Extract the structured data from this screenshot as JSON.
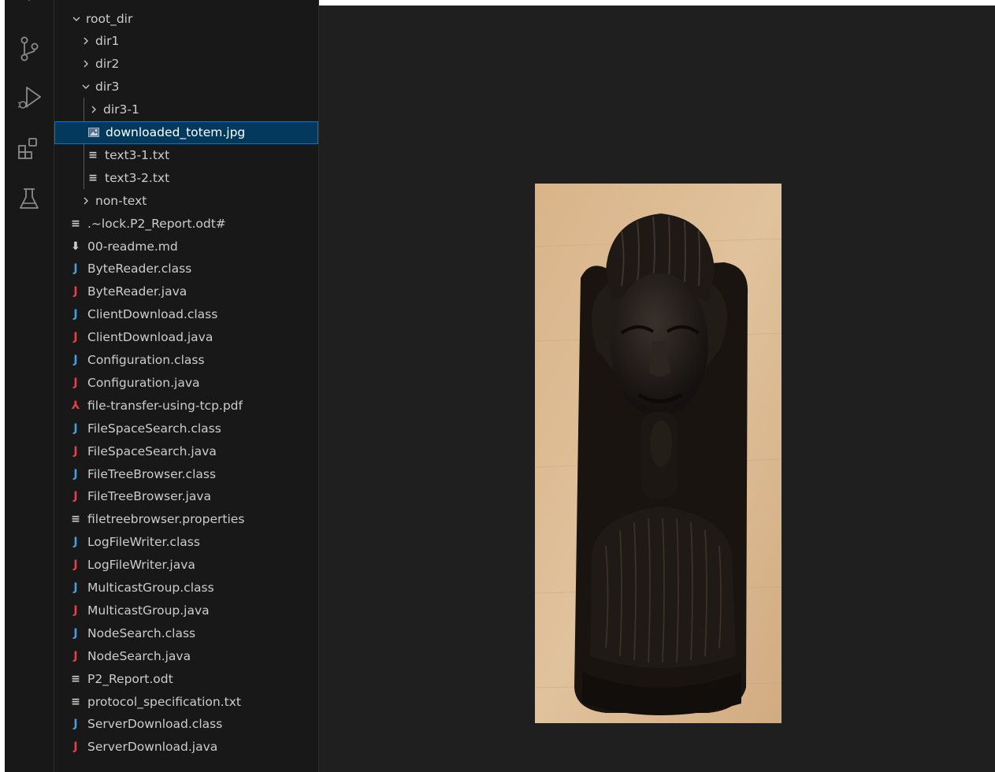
{
  "activity_bar": {
    "icons": [
      "source-control-icon",
      "run-debug-icon",
      "extensions-icon",
      "testing-icon"
    ]
  },
  "explorer": {
    "items": [
      {
        "label": "root_dir",
        "type": "folder",
        "expanded": true
      },
      {
        "label": "dir1",
        "type": "folder",
        "expanded": false
      },
      {
        "label": "dir2",
        "type": "folder",
        "expanded": false
      },
      {
        "label": "dir3",
        "type": "folder",
        "expanded": true
      },
      {
        "label": "dir3-1",
        "type": "folder",
        "expanded": false
      },
      {
        "label": "downloaded_totem.jpg",
        "type": "image",
        "selected": true
      },
      {
        "label": "text3-1.txt",
        "type": "text"
      },
      {
        "label": "text3-2.txt",
        "type": "text"
      },
      {
        "label": "non-text",
        "type": "folder",
        "expanded": false
      },
      {
        "label": ".~lock.P2_Report.odt#",
        "type": "text"
      },
      {
        "label": "00-readme.md",
        "type": "markdown"
      },
      {
        "label": "ByteReader.class",
        "type": "class"
      },
      {
        "label": "ByteReader.java",
        "type": "java"
      },
      {
        "label": "ClientDownload.class",
        "type": "class"
      },
      {
        "label": "ClientDownload.java",
        "type": "java"
      },
      {
        "label": "Configuration.class",
        "type": "class"
      },
      {
        "label": "Configuration.java",
        "type": "java"
      },
      {
        "label": "file-transfer-using-tcp.pdf",
        "type": "pdf"
      },
      {
        "label": "FileSpaceSearch.class",
        "type": "class"
      },
      {
        "label": "FileSpaceSearch.java",
        "type": "java"
      },
      {
        "label": "FileTreeBrowser.class",
        "type": "class"
      },
      {
        "label": "FileTreeBrowser.java",
        "type": "java"
      },
      {
        "label": "filetreebrowser.properties",
        "type": "text"
      },
      {
        "label": "LogFileWriter.class",
        "type": "class"
      },
      {
        "label": "LogFileWriter.java",
        "type": "java"
      },
      {
        "label": "MulticastGroup.class",
        "type": "class"
      },
      {
        "label": "MulticastGroup.java",
        "type": "java"
      },
      {
        "label": "NodeSearch.class",
        "type": "class"
      },
      {
        "label": "NodeSearch.java",
        "type": "java"
      },
      {
        "label": "P2_Report.odt",
        "type": "text"
      },
      {
        "label": "protocol_specification.txt",
        "type": "text"
      },
      {
        "label": "ServerDownload.class",
        "type": "class"
      },
      {
        "label": "ServerDownload.java",
        "type": "java"
      }
    ]
  },
  "icon_glyphs": {
    "java": "J",
    "class": "J",
    "text": "≡",
    "markdown": "⬇",
    "pdf": "⅄"
  },
  "editor": {
    "preview_icon": "image-preview",
    "colors": {
      "background": "#1f1f1f",
      "wood": "#d7b38a",
      "sculpture": "#1a1613",
      "selection": "#04395e",
      "selection_border": "#0078d4"
    }
  }
}
